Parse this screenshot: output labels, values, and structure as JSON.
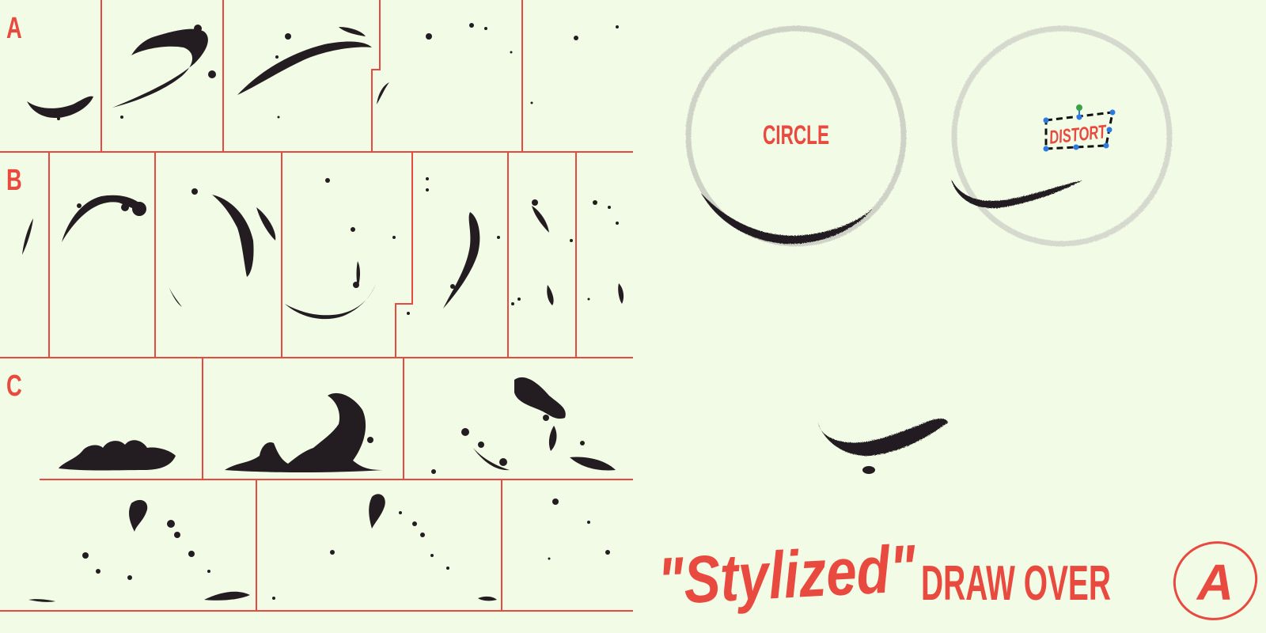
{
  "sheet": {
    "rows": [
      {
        "label": "A"
      },
      {
        "label": "B"
      },
      {
        "label": "C"
      }
    ]
  },
  "guides": {
    "circle_label": "CIRCLE",
    "distort_label": "DISTORT"
  },
  "title": {
    "script": "\"Stylized\"",
    "main": "DRAW OVER",
    "logo": "A"
  },
  "colors": {
    "background": "#f2fbe6",
    "accent": "#e84a3f",
    "ink": "#231c20",
    "guide": "#cfd2c6",
    "handle_blue": "#2a7ae2",
    "handle_green": "#3aa34a"
  }
}
